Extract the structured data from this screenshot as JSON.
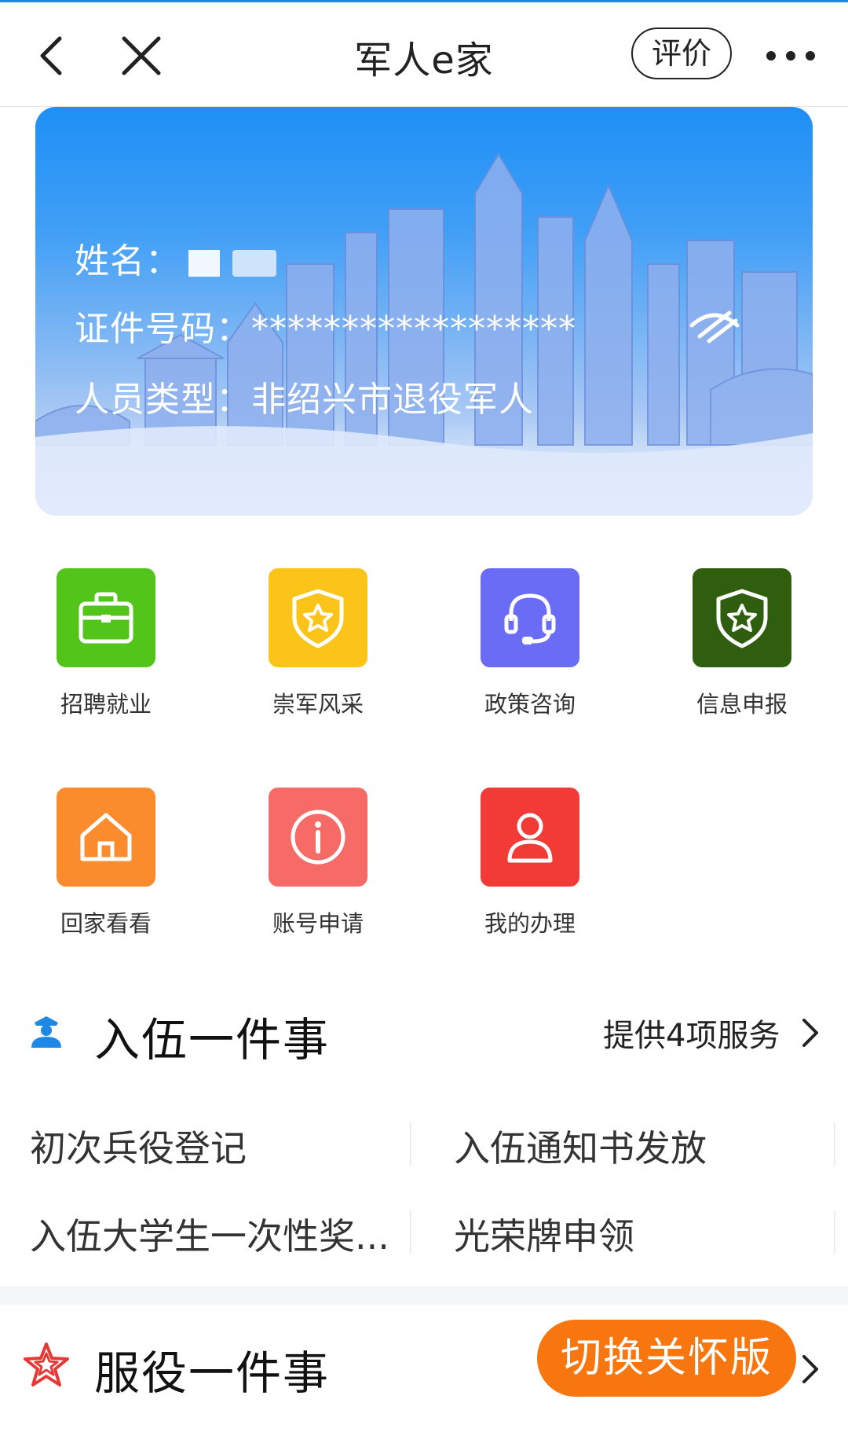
{
  "nav": {
    "title": "军人e家",
    "rate_label": "评价"
  },
  "profile": {
    "name_label": "姓名：",
    "id_label": "证件号码：",
    "id_value": "******************",
    "type_label": "人员类型：",
    "type_value": "非绍兴市退役军人"
  },
  "services": [
    {
      "label": "招聘就业",
      "icon": "briefcase-icon",
      "color": "#52c41a"
    },
    {
      "label": "崇军风采",
      "icon": "shield-star-icon",
      "color": "#fcc419"
    },
    {
      "label": "政策咨询",
      "icon": "headset-icon",
      "color": "#6b6cf6"
    },
    {
      "label": "信息申报",
      "icon": "shield-star-icon",
      "color": "#2e5e0e"
    },
    {
      "label": "回家看看",
      "icon": "home-icon",
      "color": "#fb8c2e"
    },
    {
      "label": "账号申请",
      "icon": "info-icon",
      "color": "#f76b67"
    },
    {
      "label": "我的办理",
      "icon": "user-icon",
      "color": "#f23b36"
    }
  ],
  "enlist": {
    "title": "入伍一件事",
    "more": "提供4项服务",
    "items": [
      "初次兵役登记",
      "入伍通知书发放",
      "入伍大学生一次性奖...",
      "光荣牌申领"
    ]
  },
  "service_section": {
    "title": "服役一件事"
  },
  "care_button": "切换关怀版"
}
